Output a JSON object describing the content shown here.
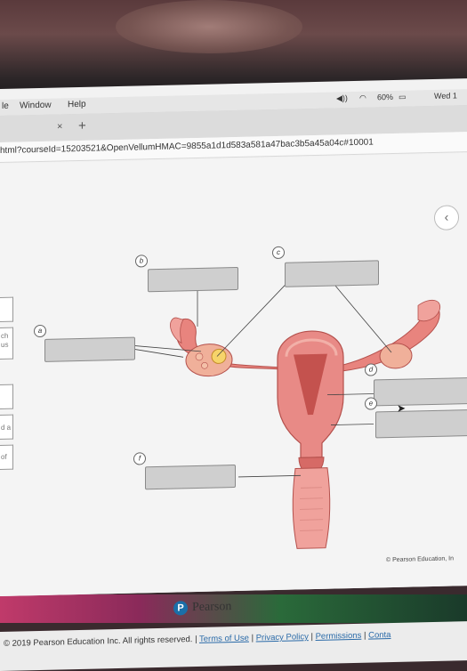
{
  "menubar": {
    "items": [
      "le",
      "Window",
      "Help"
    ],
    "battery": "60%",
    "clock": "Wed 1"
  },
  "tabbar": {
    "close": "×",
    "new_tab": "+"
  },
  "url": {
    "text": "html?courseId=15203521&OpenVellumHMAC=9855a1d1d583a581a47bac3b5a45a04c#10001"
  },
  "left_panel": {
    "text_1": "ch",
    "text_2": "us",
    "text_3": "d a",
    "text_4": "of"
  },
  "diagram": {
    "markers": {
      "a": "a",
      "b": "b",
      "c": "c",
      "d": "d",
      "e": "e",
      "f": "f"
    },
    "credit": "© Pearson Education, In"
  },
  "brand": {
    "logo_letter": "P",
    "name": "Pearson"
  },
  "footer": {
    "copyright": "© 2019 Pearson Education Inc. All rights reserved. |",
    "links": [
      "Terms of Use",
      "Privacy Policy",
      "Permissions",
      "Conta"
    ]
  },
  "colors": {
    "tissue": "#e88a86",
    "tissue_dark": "#c4524e",
    "box": "#cfcfcf",
    "pearson_blue": "#1a6fa8",
    "link": "#2a6aa8"
  }
}
